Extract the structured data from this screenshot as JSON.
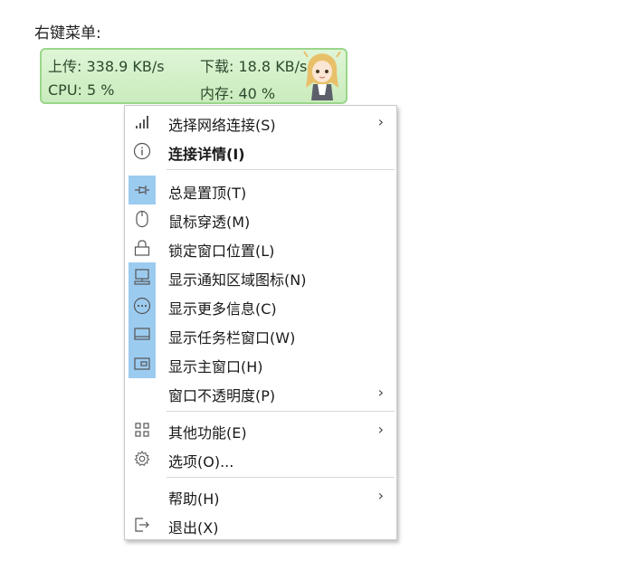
{
  "heading": "右键菜单:",
  "monitor": {
    "upload": "上传: 338.9 KB/s",
    "download": "下载: 18.8 KB/s",
    "cpu": "CPU: 5 %",
    "memory": "内存: 40 %"
  },
  "menu": {
    "items": [
      {
        "label": "选择网络连接(S)",
        "icon": "signal-bars-icon",
        "checked": false,
        "submenu": true
      },
      {
        "label": "连接详情(I)",
        "icon": "info-icon",
        "checked": false,
        "bold": true
      },
      {
        "label": "总是置顶(T)",
        "icon": "pin-icon",
        "checked": true
      },
      {
        "label": "鼠标穿透(M)",
        "icon": "mouse-icon",
        "checked": false
      },
      {
        "label": "锁定窗口位置(L)",
        "icon": "lock-icon",
        "checked": false
      },
      {
        "label": "显示通知区域图标(N)",
        "icon": "tray-icon",
        "checked": true
      },
      {
        "label": "显示更多信息(C)",
        "icon": "more-icon",
        "checked": true
      },
      {
        "label": "显示任务栏窗口(W)",
        "icon": "taskbar-icon",
        "checked": true
      },
      {
        "label": "显示主窗口(H)",
        "icon": "window-icon",
        "checked": true
      },
      {
        "label": "窗口不透明度(P)",
        "icon": "",
        "checked": false,
        "submenu": true
      },
      {
        "label": "其他功能(E)",
        "icon": "grid-icon",
        "checked": false,
        "submenu": true
      },
      {
        "label": "选项(O)...",
        "icon": "gear-icon",
        "checked": false
      },
      {
        "label": "帮助(H)",
        "icon": "",
        "checked": false,
        "submenu": true
      },
      {
        "label": "退出(X)",
        "icon": "exit-icon",
        "checked": false
      }
    ],
    "submenu_arrow": "›"
  },
  "colors": {
    "checked_bg": "#9ccbf0",
    "monitor_bg": "#d4f0ca",
    "monitor_border": "#9bd68a"
  }
}
